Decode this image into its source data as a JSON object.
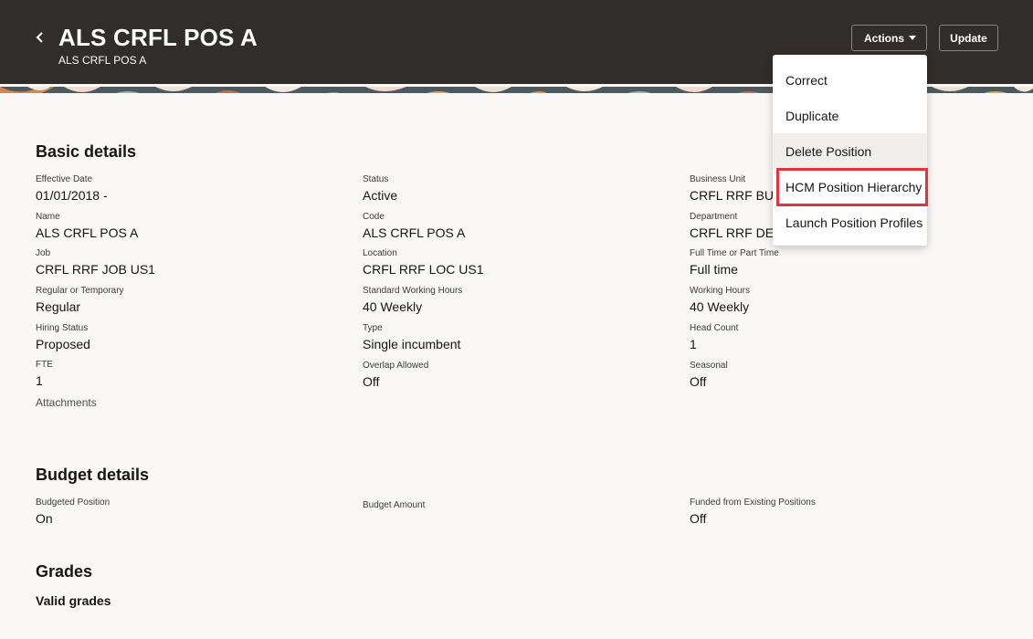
{
  "header": {
    "title": "ALS CRFL POS A",
    "subtitle": "ALS CRFL POS A",
    "actions_label": "Actions",
    "update_label": "Update",
    "back_icon": "chevron-left-icon"
  },
  "menu": {
    "items": [
      {
        "label": "Correct"
      },
      {
        "label": "Duplicate"
      },
      {
        "label": "Delete Position"
      },
      {
        "label": "HCM Position Hierarchy"
      },
      {
        "label": "Launch Position Profiles"
      }
    ],
    "highlight_color": "#e3343e"
  },
  "basic": {
    "title": "Basic details",
    "fields": [
      {
        "label": "Effective Date",
        "value": "01/01/2018 -"
      },
      {
        "label": "Status",
        "value": "Active"
      },
      {
        "label": "Business Unit",
        "value": "CRFL RRF BU U"
      },
      {
        "label": "Name",
        "value": "ALS CRFL POS A"
      },
      {
        "label": "Code",
        "value": "ALS CRFL POS A"
      },
      {
        "label": "Department",
        "value": "CRFL RRF DEP U"
      },
      {
        "label": "Job",
        "value": "CRFL RRF JOB US1"
      },
      {
        "label": "Location",
        "value": "CRFL RRF LOC US1"
      },
      {
        "label": "Full Time or Part Time",
        "value": "Full time"
      },
      {
        "label": "Regular or Temporary",
        "value": "Regular"
      },
      {
        "label": "Standard Working Hours",
        "value": "40 Weekly"
      },
      {
        "label": "Working Hours",
        "value": "40 Weekly"
      },
      {
        "label": "Hiring Status",
        "value": "Proposed"
      },
      {
        "label": "Type",
        "value": "Single incumbent"
      },
      {
        "label": "Head Count",
        "value": "1"
      },
      {
        "label": "FTE",
        "value": "1"
      },
      {
        "label": "Overlap Allowed",
        "value": "Off"
      },
      {
        "label": "Seasonal",
        "value": "Off"
      }
    ],
    "attachments_label": "Attachments"
  },
  "budget": {
    "title": "Budget details",
    "fields": [
      {
        "label": "Budgeted Position",
        "value": "On"
      },
      {
        "label": "Budget Amount",
        "value": ""
      },
      {
        "label": "Funded from Existing Positions",
        "value": "Off"
      }
    ]
  },
  "grades": {
    "title": "Grades",
    "valid_grades_label": "Valid grades"
  },
  "colors": {
    "header_bg": "#312d2a",
    "page_bg": "#f9f8f6"
  }
}
